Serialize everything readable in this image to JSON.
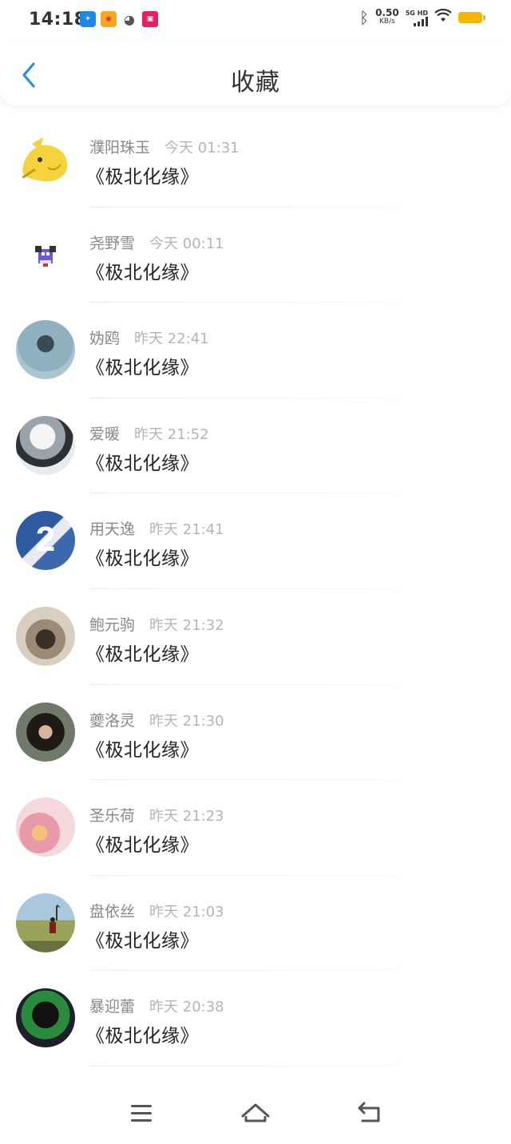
{
  "status_bar": {
    "time": "14:18",
    "net_speed_value": "0.50",
    "net_speed_unit": "KB/s",
    "network_type": "5G HD"
  },
  "header": {
    "title": "收藏",
    "back_icon": "chevron-left-icon"
  },
  "favorites": [
    {
      "name": "濮阳珠玉",
      "time": "今天 01:31",
      "book": "《极北化缘》"
    },
    {
      "name": "尧野雪",
      "time": "今天 00:11",
      "book": "《极北化缘》"
    },
    {
      "name": "妫鸥",
      "time": "昨天 22:41",
      "book": "《极北化缘》"
    },
    {
      "name": "爱暖",
      "time": "昨天 21:52",
      "book": "《极北化缘》"
    },
    {
      "name": "用天逸",
      "time": "昨天 21:41",
      "book": "《极北化缘》"
    },
    {
      "name": "鲍元驹",
      "time": "昨天 21:32",
      "book": "《极北化缘》"
    },
    {
      "name": "夔洛灵",
      "time": "昨天 21:30",
      "book": "《极北化缘》"
    },
    {
      "name": "圣乐荷",
      "time": "昨天 21:23",
      "book": "《极北化缘》"
    },
    {
      "name": "盘依丝",
      "time": "昨天 21:03",
      "book": "《极北化缘》"
    },
    {
      "name": "暴迎蕾",
      "time": "昨天 20:38",
      "book": "《极北化缘》"
    }
  ],
  "nav_bar": {
    "menu_icon": "menu-icon",
    "home_icon": "home-icon",
    "back_icon": "back-arrow-icon"
  },
  "colors": {
    "accent": "#2b8fe0",
    "battery": "#f7b500"
  }
}
